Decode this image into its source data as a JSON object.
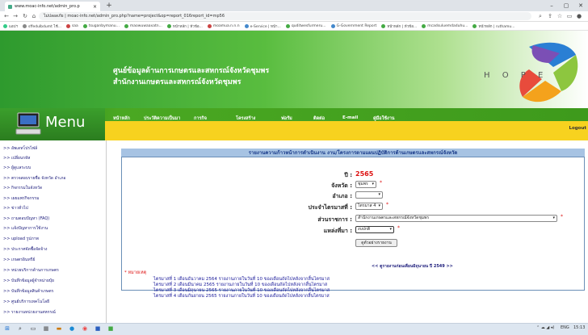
{
  "browser": {
    "tab_title": "www.moac-info.net/admin_pro.p",
    "url": "ไม่ปลอดภัย | moac-info.net/admin_pro.php?name=project&op=report_016report_id=mp56",
    "bookmarks": [
      "แอปฯ",
      "sffedulbdumt ไช้...",
      "saa",
      "tsuganbymanu...",
      "maowuwaaxatn...",
      "หน้าหลัก | หัวข้อ...",
      "moamua.n.n.n",
      "e-Service | หน้า...",
      "quditwesfurmeru...",
      "G-Government Report",
      "หน้าหลัก | หัวข้อ...",
      "mcadsuluemdaduhu...",
      "หน้าหลัก | ruthamu..."
    ]
  },
  "header": {
    "title_line1": "ศูนย์ข้อมูลด้านการเกษตรและสหกรณ์จังหวัดชุมพร",
    "title_line2": "สำนักงานเกษตรและสหกรณ์จังหวัดชุมพร",
    "logo_text": "H O P E"
  },
  "menu_label": "Menu",
  "nav": [
    "หน้าหลัก",
    "ประวัติความเป็นมา",
    "การกิจ",
    "โครงสร้าง",
    "ฟอรัม",
    "ติดต่อ",
    "E-mail",
    "คู่มือใช้งาน"
  ],
  "logout": "Logout",
  "sidebar": [
    ">> อัพเดทโปรไฟล์",
    ">> เปลี่ยนรหัส",
    ">> ผู้ดูแลระบบ",
    ">> ตรวจสอบรายชื่อ จังหวัด อำเภอ",
    ">> กิจกรรมในจังหวัด",
    ">> เผยแพร่กิจกรรม",
    ">> ข่าวทั่วไป",
    ">> ถามตอบปัญหา (FAQ)",
    ">> แจ้งปัญหาการใช้งาน",
    ">> upload รูปภาพ",
    ">> ประกาศจัดซื้อจัดจ้าง",
    ">> เกษตรอินทรีย์",
    ">> หน่วยบริการด้านการเกษตร",
    ">> บันทึกข้อมูลผู้จำหน่ายปุ๋ย",
    ">> บันทึกข้อมูลสินค้าเกษตร",
    ">> ศูนย์บริการเทคโนโลยี",
    ">> รายงานหน่วยงานสหกรณ์"
  ],
  "report": {
    "heading": "รายงานความก้าวหน้าการดำเนินงาน งาน/โครงการตามแผนปฏิบัติการด้านเกษตรและสหกรณ์จังหวัด",
    "year_label": "ปี :",
    "year": "2565",
    "province_label": "จังหวัด :",
    "province_value": "ชุมพร",
    "district_label": "อำเภอ :",
    "district_value": "",
    "quarter_label": "ประจำไตรมาสที่ :",
    "quarter_value": "ไตรมาส 4",
    "agency_label": "ส่วนราชการ :",
    "agency_value": "สำนักงานเกษตรและสหกรณ์จังหวัดชุมพร",
    "source_label": "แหล่งที่มา :",
    "source_value": "งบปกติ",
    "submit": "ดูตัวอย่างรายงาน",
    "old_report_link": "<< ดูรายงานก่อนเดือนมิถุนายน ปี 2549 >>",
    "note_label": "* หมายเหตุ",
    "notes": [
      "ไตรมาสที่ 1 เดือนธันวาคม 2564 รายงานภายในวันที่ 10 ของเดือนถัดไปหลังจากสิ้นไตรมาส",
      "ไตรมาสที่ 2 เดือนมีนาคม 2565 รายงานภายในวันที่ 10 ของเดือนถัดไปหลังจากสิ้นไตรมาส",
      "ไตรมาสที่ 3 เดือนมิถุนายน 2565 รายงานภายในวันที่ 10 ของเดือนถัดไปหลังจากสิ้นไตรมาส",
      "ไตรมาสที่ 4 เดือนกันยายน 2565 รายงานภายในวันที่ 10 ของเดือนถัดไปหลังจากสิ้นไตรมาส"
    ]
  },
  "taskbar": {
    "tray_lang": "ENG",
    "tray_time": "15:13"
  }
}
